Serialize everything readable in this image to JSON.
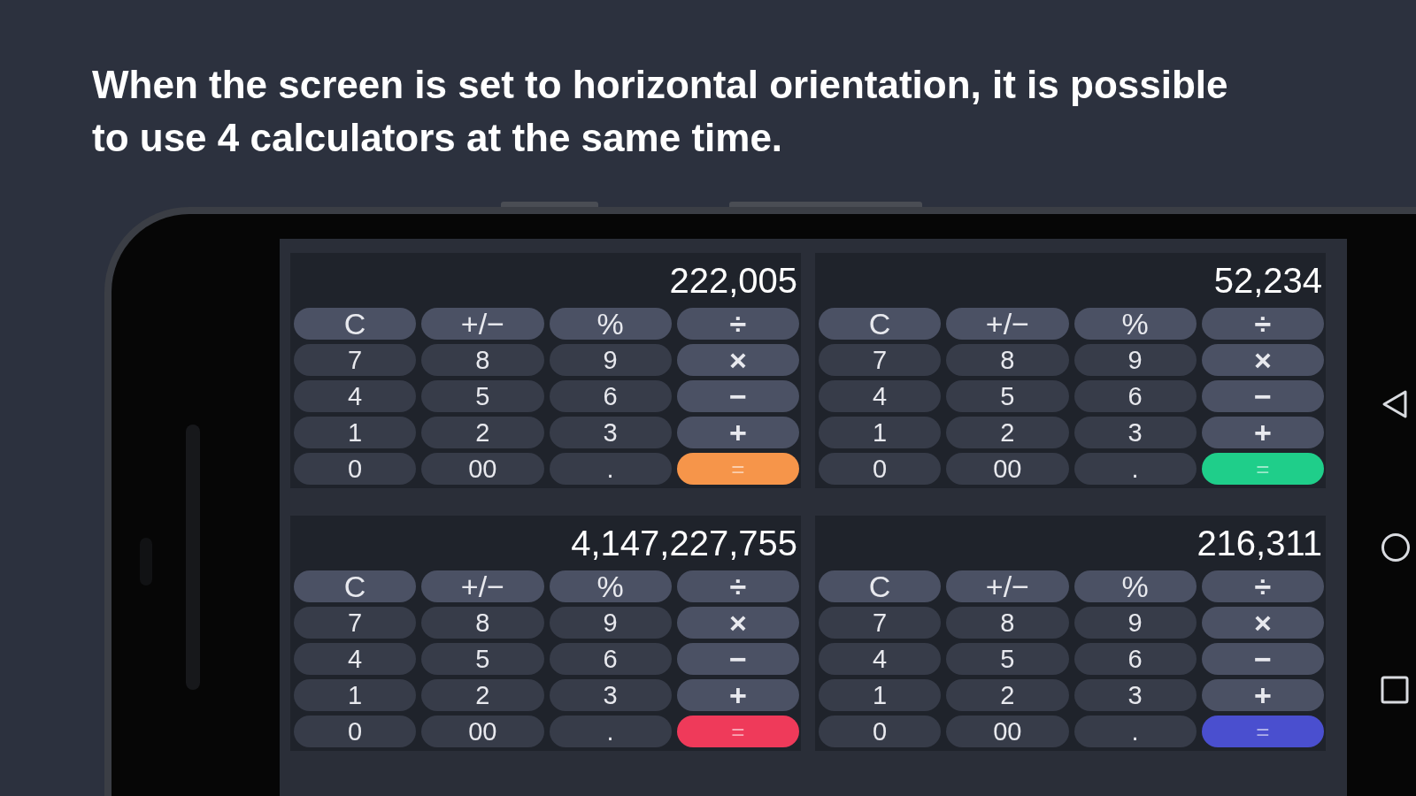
{
  "headline": "When the screen is set to horizontal orientation, it is possible to use 4 calculators at the same time.",
  "calculators": [
    {
      "display": "222,005",
      "keys": [
        {
          "label": "C",
          "kind": "function"
        },
        {
          "label": "+/−",
          "kind": "function"
        },
        {
          "label": "%",
          "kind": "function"
        },
        {
          "label": "÷",
          "kind": "operator"
        },
        {
          "label": "7",
          "kind": "digit"
        },
        {
          "label": "8",
          "kind": "digit"
        },
        {
          "label": "9",
          "kind": "digit"
        },
        {
          "label": "×",
          "kind": "operator"
        },
        {
          "label": "4",
          "kind": "digit"
        },
        {
          "label": "5",
          "kind": "digit"
        },
        {
          "label": "6",
          "kind": "digit"
        },
        {
          "label": "−",
          "kind": "operator"
        },
        {
          "label": "1",
          "kind": "digit"
        },
        {
          "label": "2",
          "kind": "digit"
        },
        {
          "label": "3",
          "kind": "digit"
        },
        {
          "label": "+",
          "kind": "operator"
        },
        {
          "label": "0",
          "kind": "digit"
        },
        {
          "label": "00",
          "kind": "digit"
        },
        {
          "label": ".",
          "kind": "digit"
        },
        {
          "label": "=",
          "kind": "equals",
          "color": "#f6954a"
        }
      ]
    },
    {
      "display": "52,234",
      "keys": [
        {
          "label": "C",
          "kind": "function"
        },
        {
          "label": "+/−",
          "kind": "function"
        },
        {
          "label": "%",
          "kind": "function"
        },
        {
          "label": "÷",
          "kind": "operator"
        },
        {
          "label": "7",
          "kind": "digit"
        },
        {
          "label": "8",
          "kind": "digit"
        },
        {
          "label": "9",
          "kind": "digit"
        },
        {
          "label": "×",
          "kind": "operator"
        },
        {
          "label": "4",
          "kind": "digit"
        },
        {
          "label": "5",
          "kind": "digit"
        },
        {
          "label": "6",
          "kind": "digit"
        },
        {
          "label": "−",
          "kind": "operator"
        },
        {
          "label": "1",
          "kind": "digit"
        },
        {
          "label": "2",
          "kind": "digit"
        },
        {
          "label": "3",
          "kind": "digit"
        },
        {
          "label": "+",
          "kind": "operator"
        },
        {
          "label": "0",
          "kind": "digit"
        },
        {
          "label": "00",
          "kind": "digit"
        },
        {
          "label": ".",
          "kind": "digit"
        },
        {
          "label": "=",
          "kind": "equals",
          "color": "#1fce8a"
        }
      ]
    },
    {
      "display": "4,147,227,755",
      "keys": [
        {
          "label": "C",
          "kind": "function"
        },
        {
          "label": "+/−",
          "kind": "function"
        },
        {
          "label": "%",
          "kind": "function"
        },
        {
          "label": "÷",
          "kind": "operator"
        },
        {
          "label": "7",
          "kind": "digit"
        },
        {
          "label": "8",
          "kind": "digit"
        },
        {
          "label": "9",
          "kind": "digit"
        },
        {
          "label": "×",
          "kind": "operator"
        },
        {
          "label": "4",
          "kind": "digit"
        },
        {
          "label": "5",
          "kind": "digit"
        },
        {
          "label": "6",
          "kind": "digit"
        },
        {
          "label": "−",
          "kind": "operator"
        },
        {
          "label": "1",
          "kind": "digit"
        },
        {
          "label": "2",
          "kind": "digit"
        },
        {
          "label": "3",
          "kind": "digit"
        },
        {
          "label": "+",
          "kind": "operator"
        },
        {
          "label": "0",
          "kind": "digit"
        },
        {
          "label": "00",
          "kind": "digit"
        },
        {
          "label": ".",
          "kind": "digit"
        },
        {
          "label": "=",
          "kind": "equals",
          "color": "#ef3a5a"
        }
      ]
    },
    {
      "display": "216,311",
      "keys": [
        {
          "label": "C",
          "kind": "function"
        },
        {
          "label": "+/−",
          "kind": "function"
        },
        {
          "label": "%",
          "kind": "function"
        },
        {
          "label": "÷",
          "kind": "operator"
        },
        {
          "label": "7",
          "kind": "digit"
        },
        {
          "label": "8",
          "kind": "digit"
        },
        {
          "label": "9",
          "kind": "digit"
        },
        {
          "label": "×",
          "kind": "operator"
        },
        {
          "label": "4",
          "kind": "digit"
        },
        {
          "label": "5",
          "kind": "digit"
        },
        {
          "label": "6",
          "kind": "digit"
        },
        {
          "label": "−",
          "kind": "operator"
        },
        {
          "label": "1",
          "kind": "digit"
        },
        {
          "label": "2",
          "kind": "digit"
        },
        {
          "label": "3",
          "kind": "digit"
        },
        {
          "label": "+",
          "kind": "operator"
        },
        {
          "label": "0",
          "kind": "digit"
        },
        {
          "label": "00",
          "kind": "digit"
        },
        {
          "label": ".",
          "kind": "digit"
        },
        {
          "label": "=",
          "kind": "equals",
          "color": "#4a4fcf"
        }
      ]
    }
  ]
}
